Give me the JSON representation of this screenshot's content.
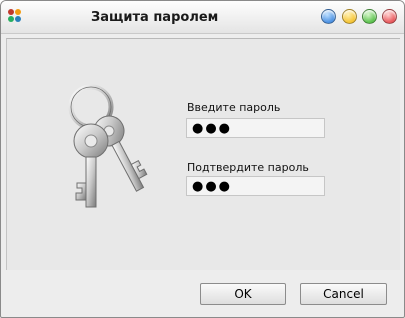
{
  "window": {
    "title": "Защита паролем",
    "controls": [
      {
        "name": "minimize",
        "color": "#4a90e2"
      },
      {
        "name": "collapse",
        "color": "#f5c332"
      },
      {
        "name": "maximize",
        "color": "#5ac24c"
      },
      {
        "name": "close",
        "color": "#e8565a"
      }
    ]
  },
  "form": {
    "password_label": "Введите пароль",
    "password_value": "●●●",
    "confirm_label": "Подтвердите пароль",
    "confirm_value": "●●●"
  },
  "buttons": {
    "ok_label": "OK",
    "cancel_label": "Cancel"
  },
  "icons": {
    "app": "app-flower-icon",
    "illustration": "keys-icon"
  }
}
